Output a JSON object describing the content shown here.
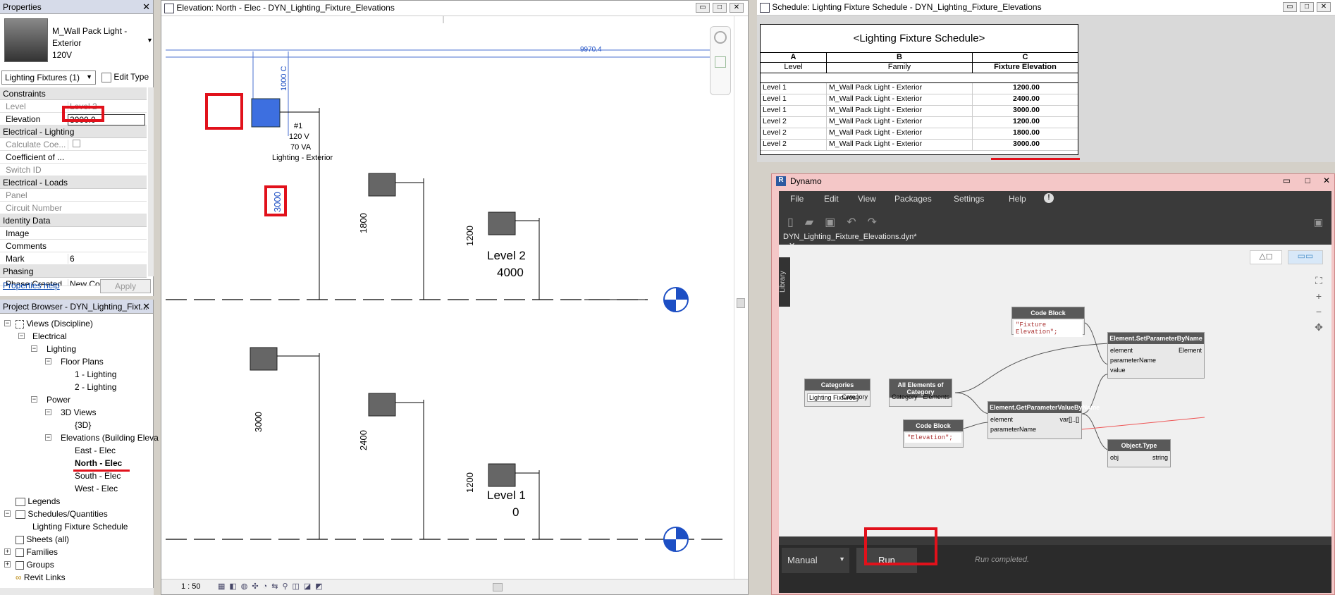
{
  "properties": {
    "title": "Properties",
    "type_name": "M_Wall Pack Light - Exterior",
    "type_sub": "120V",
    "selector": "Lighting Fixtures (1)",
    "edit_type": "Edit Type",
    "groups": {
      "constraints": "Constraints",
      "elec_lighting": "Electrical - Lighting",
      "elec_loads": "Electrical - Loads",
      "identity": "Identity Data",
      "phasing": "Phasing"
    },
    "rows": {
      "level_k": "Level",
      "level_v": "Level 2",
      "elev_k": "Elevation",
      "elev_v": "3000.0",
      "calc_k": "Calculate Coe...",
      "coef_k": "Coefficient of ...",
      "switch_k": "Switch ID",
      "panel_k": "Panel",
      "circuit_k": "Circuit Number",
      "image_k": "Image",
      "comments_k": "Comments",
      "mark_k": "Mark",
      "mark_v": "6",
      "phase_k": "Phase Created",
      "phase_v": "New Construct"
    },
    "help": "Properties help",
    "apply": "Apply"
  },
  "browser": {
    "title": "Project Browser - DYN_Lighting_Fixt...",
    "items": {
      "views": "Views (Discipline)",
      "electrical": "Electrical",
      "lighting": "Lighting",
      "floorplans": "Floor Plans",
      "fp1": "1 - Lighting",
      "fp2": "2 - Lighting",
      "power": "Power",
      "views3d": "3D Views",
      "v3d": "{3D}",
      "elevations": "Elevations (Building Eleva",
      "east": "East - Elec",
      "north": "North - Elec",
      "south": "South - Elec",
      "west": "West - Elec",
      "legends": "Legends",
      "schedules": "Schedules/Quantities",
      "lfs": "Lighting Fixture Schedule",
      "sheets": "Sheets (all)",
      "families": "Families",
      "groups": "Groups",
      "revitlinks": "Revit Links"
    }
  },
  "elevation": {
    "title": "Elevation: North - Elec - DYN_Lighting_Fixture_Elevations",
    "dim_top": "9970.4",
    "dim_1000": "1000 C",
    "dim_3000_sel": "3000",
    "tag_num": "#1",
    "tag_v": "120 V",
    "tag_va": "70 VA",
    "tag_name": "Lighting - Exterior",
    "dim_1800": "1800",
    "dim_1200a": "1200",
    "level2": "Level 2",
    "level2_val": "4000",
    "dim_3000": "3000",
    "dim_2400": "2400",
    "dim_1200b": "1200",
    "level1": "Level 1",
    "level1_val": "0",
    "scale": "1 : 50"
  },
  "schedule": {
    "title": "Schedule: Lighting Fixture Schedule - DYN_Lighting_Fixture_Elevations",
    "table_title": "<Lighting Fixture Schedule>",
    "col_letters": [
      "A",
      "B",
      "C"
    ],
    "col_names": [
      "Level",
      "Family",
      "Fixture Elevation"
    ],
    "rows": [
      [
        "Level 1",
        "M_Wall Pack Light - Exterior",
        "1200.00"
      ],
      [
        "Level 1",
        "M_Wall Pack Light - Exterior",
        "2400.00"
      ],
      [
        "Level 1",
        "M_Wall Pack Light - Exterior",
        "3000.00"
      ],
      [
        "Level 2",
        "M_Wall Pack Light - Exterior",
        "1200.00"
      ],
      [
        "Level 2",
        "M_Wall Pack Light - Exterior",
        "1800.00"
      ],
      [
        "Level 2",
        "M_Wall Pack Light - Exterior",
        "3000.00"
      ]
    ]
  },
  "dynamo": {
    "title": "Dynamo",
    "menu": [
      "File",
      "Edit",
      "View",
      "Packages",
      "Settings",
      "Help"
    ],
    "tab": "DYN_Lighting_Fixture_Elevations.dyn*",
    "library": "Library",
    "nodes": {
      "cb1_title": "Code Block",
      "cb1_code": "\"Fixture Elevation\";",
      "sp_title": "Element.SetParameterByName",
      "sp_in1": "element",
      "sp_in2": "parameterName",
      "sp_in3": "value",
      "sp_out": "Element",
      "cat_title": "Categories",
      "cat_value": "Lighting Fixtures",
      "cat_out": "Category",
      "aec_title": "All Elements of Category",
      "aec_in": "Category",
      "aec_out": "Elements",
      "gp_title": "Element.GetParameterValueByName",
      "gp_in1": "element",
      "gp_in2": "parameterName",
      "gp_out": "var[]..[]",
      "cb2_title": "Code Block",
      "cb2_code": "\"Elevation\";",
      "ot_title": "Object.Type",
      "ot_in": "obj",
      "ot_out": "string"
    },
    "run_mode": "Manual",
    "run": "Run",
    "status": "Run completed."
  }
}
